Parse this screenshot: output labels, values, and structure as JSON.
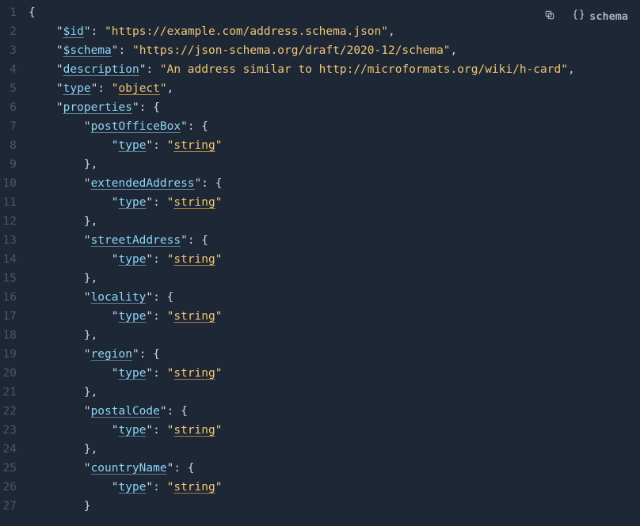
{
  "toolbar": {
    "schema_label": "schema"
  },
  "code": {
    "lines": [
      {
        "n": 1,
        "pre": "",
        "segs": [
          {
            "t": "{",
            "c": "p"
          }
        ]
      },
      {
        "n": 2,
        "pre": "  ",
        "segs": [
          {
            "t": "\"",
            "c": "q"
          },
          {
            "t": "$id",
            "c": "key"
          },
          {
            "t": "\"",
            "c": "q"
          },
          {
            "t": ": ",
            "c": "p"
          },
          {
            "t": "\"https://example.com/address.schema.json\"",
            "c": "str"
          },
          {
            "t": ",",
            "c": "p"
          }
        ]
      },
      {
        "n": 3,
        "pre": "  ",
        "segs": [
          {
            "t": "\"",
            "c": "q"
          },
          {
            "t": "$schema",
            "c": "key"
          },
          {
            "t": "\"",
            "c": "q"
          },
          {
            "t": ": ",
            "c": "p"
          },
          {
            "t": "\"https://json-schema.org/draft/2020-12/schema\"",
            "c": "str"
          },
          {
            "t": ",",
            "c": "p"
          }
        ]
      },
      {
        "n": 4,
        "pre": "  ",
        "segs": [
          {
            "t": "\"",
            "c": "q"
          },
          {
            "t": "description",
            "c": "key"
          },
          {
            "t": "\"",
            "c": "q"
          },
          {
            "t": ": ",
            "c": "p"
          },
          {
            "t": "\"An address similar to http://microformats.org/wiki/h-card\"",
            "c": "str"
          },
          {
            "t": ",",
            "c": "p"
          }
        ]
      },
      {
        "n": 5,
        "pre": "  ",
        "segs": [
          {
            "t": "\"",
            "c": "q"
          },
          {
            "t": "type",
            "c": "key"
          },
          {
            "t": "\"",
            "c": "q"
          },
          {
            "t": ": ",
            "c": "p"
          },
          {
            "t": "\"",
            "c": "str"
          },
          {
            "t": "object",
            "c": "strul"
          },
          {
            "t": "\"",
            "c": "str"
          },
          {
            "t": ",",
            "c": "p"
          }
        ]
      },
      {
        "n": 6,
        "pre": "  ",
        "segs": [
          {
            "t": "\"",
            "c": "q"
          },
          {
            "t": "properties",
            "c": "key"
          },
          {
            "t": "\"",
            "c": "q"
          },
          {
            "t": ": {",
            "c": "p"
          }
        ]
      },
      {
        "n": 7,
        "pre": "    ",
        "segs": [
          {
            "t": "\"",
            "c": "q"
          },
          {
            "t": "postOfficeBox",
            "c": "key"
          },
          {
            "t": "\"",
            "c": "q"
          },
          {
            "t": ": {",
            "c": "p"
          }
        ]
      },
      {
        "n": 8,
        "pre": "      ",
        "segs": [
          {
            "t": "\"",
            "c": "q"
          },
          {
            "t": "type",
            "c": "key"
          },
          {
            "t": "\"",
            "c": "q"
          },
          {
            "t": ": ",
            "c": "p"
          },
          {
            "t": "\"",
            "c": "str"
          },
          {
            "t": "string",
            "c": "strul"
          },
          {
            "t": "\"",
            "c": "str"
          }
        ]
      },
      {
        "n": 9,
        "pre": "    ",
        "segs": [
          {
            "t": "},",
            "c": "p"
          }
        ]
      },
      {
        "n": 10,
        "pre": "    ",
        "segs": [
          {
            "t": "\"",
            "c": "q"
          },
          {
            "t": "extendedAddress",
            "c": "key"
          },
          {
            "t": "\"",
            "c": "q"
          },
          {
            "t": ": {",
            "c": "p"
          }
        ]
      },
      {
        "n": 11,
        "pre": "      ",
        "segs": [
          {
            "t": "\"",
            "c": "q"
          },
          {
            "t": "type",
            "c": "key"
          },
          {
            "t": "\"",
            "c": "q"
          },
          {
            "t": ": ",
            "c": "p"
          },
          {
            "t": "\"",
            "c": "str"
          },
          {
            "t": "string",
            "c": "strul"
          },
          {
            "t": "\"",
            "c": "str"
          }
        ]
      },
      {
        "n": 12,
        "pre": "    ",
        "segs": [
          {
            "t": "},",
            "c": "p"
          }
        ]
      },
      {
        "n": 13,
        "pre": "    ",
        "segs": [
          {
            "t": "\"",
            "c": "q"
          },
          {
            "t": "streetAddress",
            "c": "key"
          },
          {
            "t": "\"",
            "c": "q"
          },
          {
            "t": ": {",
            "c": "p"
          }
        ]
      },
      {
        "n": 14,
        "pre": "      ",
        "segs": [
          {
            "t": "\"",
            "c": "q"
          },
          {
            "t": "type",
            "c": "key"
          },
          {
            "t": "\"",
            "c": "q"
          },
          {
            "t": ": ",
            "c": "p"
          },
          {
            "t": "\"",
            "c": "str"
          },
          {
            "t": "string",
            "c": "strul"
          },
          {
            "t": "\"",
            "c": "str"
          }
        ]
      },
      {
        "n": 15,
        "pre": "    ",
        "segs": [
          {
            "t": "},",
            "c": "p"
          }
        ]
      },
      {
        "n": 16,
        "pre": "    ",
        "segs": [
          {
            "t": "\"",
            "c": "q"
          },
          {
            "t": "locality",
            "c": "key"
          },
          {
            "t": "\"",
            "c": "q"
          },
          {
            "t": ": {",
            "c": "p"
          }
        ]
      },
      {
        "n": 17,
        "pre": "      ",
        "segs": [
          {
            "t": "\"",
            "c": "q"
          },
          {
            "t": "type",
            "c": "key"
          },
          {
            "t": "\"",
            "c": "q"
          },
          {
            "t": ": ",
            "c": "p"
          },
          {
            "t": "\"",
            "c": "str"
          },
          {
            "t": "string",
            "c": "strul"
          },
          {
            "t": "\"",
            "c": "str"
          }
        ]
      },
      {
        "n": 18,
        "pre": "    ",
        "segs": [
          {
            "t": "},",
            "c": "p"
          }
        ]
      },
      {
        "n": 19,
        "pre": "    ",
        "segs": [
          {
            "t": "\"",
            "c": "q"
          },
          {
            "t": "region",
            "c": "key"
          },
          {
            "t": "\"",
            "c": "q"
          },
          {
            "t": ": {",
            "c": "p"
          }
        ]
      },
      {
        "n": 20,
        "pre": "      ",
        "segs": [
          {
            "t": "\"",
            "c": "q"
          },
          {
            "t": "type",
            "c": "key"
          },
          {
            "t": "\"",
            "c": "q"
          },
          {
            "t": ": ",
            "c": "p"
          },
          {
            "t": "\"",
            "c": "str"
          },
          {
            "t": "string",
            "c": "strul"
          },
          {
            "t": "\"",
            "c": "str"
          }
        ]
      },
      {
        "n": 21,
        "pre": "    ",
        "segs": [
          {
            "t": "},",
            "c": "p"
          }
        ]
      },
      {
        "n": 22,
        "pre": "    ",
        "segs": [
          {
            "t": "\"",
            "c": "q"
          },
          {
            "t": "postalCode",
            "c": "key"
          },
          {
            "t": "\"",
            "c": "q"
          },
          {
            "t": ": {",
            "c": "p"
          }
        ]
      },
      {
        "n": 23,
        "pre": "      ",
        "segs": [
          {
            "t": "\"",
            "c": "q"
          },
          {
            "t": "type",
            "c": "key"
          },
          {
            "t": "\"",
            "c": "q"
          },
          {
            "t": ": ",
            "c": "p"
          },
          {
            "t": "\"",
            "c": "str"
          },
          {
            "t": "string",
            "c": "strul"
          },
          {
            "t": "\"",
            "c": "str"
          }
        ]
      },
      {
        "n": 24,
        "pre": "    ",
        "segs": [
          {
            "t": "},",
            "c": "p"
          }
        ]
      },
      {
        "n": 25,
        "pre": "    ",
        "segs": [
          {
            "t": "\"",
            "c": "q"
          },
          {
            "t": "countryName",
            "c": "key"
          },
          {
            "t": "\"",
            "c": "q"
          },
          {
            "t": ": {",
            "c": "p"
          }
        ]
      },
      {
        "n": 26,
        "pre": "      ",
        "segs": [
          {
            "t": "\"",
            "c": "q"
          },
          {
            "t": "type",
            "c": "key"
          },
          {
            "t": "\"",
            "c": "q"
          },
          {
            "t": ": ",
            "c": "p"
          },
          {
            "t": "\"",
            "c": "str"
          },
          {
            "t": "string",
            "c": "strul"
          },
          {
            "t": "\"",
            "c": "str"
          }
        ]
      },
      {
        "n": 27,
        "pre": "    ",
        "segs": [
          {
            "t": "}",
            "c": "p"
          }
        ]
      }
    ]
  }
}
